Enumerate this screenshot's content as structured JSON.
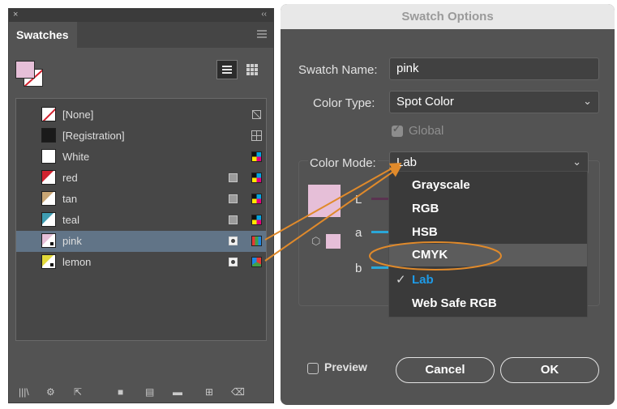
{
  "swatches_panel": {
    "close_glyph": "×",
    "collapse_glyph": "‹‹",
    "tab_label": "Swatches",
    "items": [
      {
        "name": "[None]",
        "chip_color": "#ffffff",
        "kind": "none",
        "type_icon": "",
        "mode_icon": "none-color-icon"
      },
      {
        "name": "[Registration]",
        "chip_color": "#1a1a1a",
        "kind": "registration",
        "type_icon": "",
        "mode_icon": "registration-icon"
      },
      {
        "name": "White",
        "chip_color": "#ffffff",
        "kind": "plain",
        "type_icon": "",
        "mode_icon": "cmyk-mode-icon"
      },
      {
        "name": "red",
        "chip_color": "#d0232f",
        "kind": "global",
        "type_icon": "process-color-icon",
        "mode_icon": "cmyk-mode-icon"
      },
      {
        "name": "tan",
        "chip_color": "#c8a574",
        "kind": "global",
        "type_icon": "process-color-icon",
        "mode_icon": "cmyk-mode-icon"
      },
      {
        "name": "teal",
        "chip_color": "#3f9db2",
        "kind": "global",
        "type_icon": "process-color-icon",
        "mode_icon": "cmyk-mode-icon"
      },
      {
        "name": "pink",
        "chip_color": "#e6bfd8",
        "kind": "spot",
        "type_icon": "spot-color-icon",
        "mode_icon": "lab-mode-icon",
        "selected": true
      },
      {
        "name": "lemon",
        "chip_color": "#e3d93a",
        "kind": "spot",
        "type_icon": "spot-color-icon",
        "mode_icon": "rgb-mode-icon"
      }
    ]
  },
  "dialog": {
    "title": "Swatch Options",
    "swatch_name_label": "Swatch Name:",
    "swatch_name_value": "pink",
    "color_type_label": "Color Type:",
    "color_type_value": "Spot Color",
    "global_label": "Global",
    "global_checked": true,
    "color_mode_label": "Color Mode:",
    "color_mode_value": "Lab",
    "slider_labels": [
      "L",
      "a",
      "b"
    ],
    "preview_label": "Preview",
    "cancel_label": "Cancel",
    "ok_label": "OK",
    "swatch_color": "#e6bfd8",
    "color_mode_options": [
      {
        "label": "Grayscale"
      },
      {
        "label": "RGB"
      },
      {
        "label": "HSB"
      },
      {
        "label": "CMYK",
        "highlighted": true
      },
      {
        "label": "Lab",
        "checked": true
      },
      {
        "label": "Web Safe RGB"
      }
    ]
  },
  "annotation": {
    "arrow_color": "#e08a2b"
  }
}
